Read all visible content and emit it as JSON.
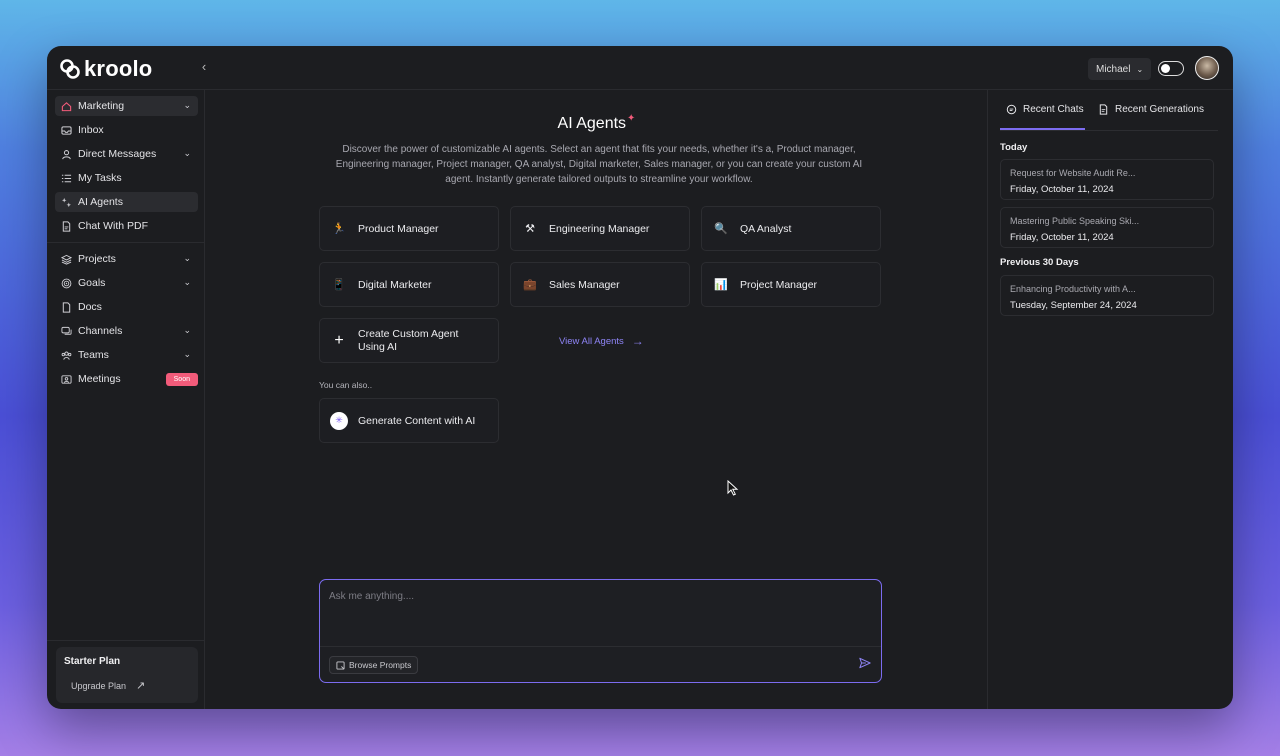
{
  "app": {
    "logo_text": "kroolo",
    "user_name": "Michael"
  },
  "sidebar": {
    "items": [
      {
        "label": "Marketing",
        "icon": "home-icon",
        "has_chevron": true
      },
      {
        "label": "Inbox",
        "icon": "inbox-icon",
        "has_chevron": false
      },
      {
        "label": "Direct Messages",
        "icon": "person-icon",
        "has_chevron": true
      },
      {
        "label": "My Tasks",
        "icon": "list-icon",
        "has_chevron": false
      },
      {
        "label": "AI Agents",
        "icon": "sparkle-icon",
        "has_chevron": false
      },
      {
        "label": "Chat With PDF",
        "icon": "pdf-icon",
        "has_chevron": false
      },
      {
        "label": "Projects",
        "icon": "layers-icon",
        "has_chevron": true
      },
      {
        "label": "Goals",
        "icon": "target-icon",
        "has_chevron": true
      },
      {
        "label": "Docs",
        "icon": "doc-icon",
        "has_chevron": false
      },
      {
        "label": "Channels",
        "icon": "chat-icon",
        "has_chevron": true
      },
      {
        "label": "Teams",
        "icon": "team-icon",
        "has_chevron": true
      },
      {
        "label": "Meetings",
        "icon": "meeting-icon",
        "has_chevron": false,
        "badge": "Soon"
      }
    ],
    "plan": {
      "title": "Starter Plan",
      "upgrade_label": "Upgrade Plan"
    }
  },
  "main": {
    "title": "AI Agents",
    "description": "Discover the power of customizable AI agents. Select an agent that fits your needs, whether it's a, Product manager, Engineering manager, Project manager, QA analyst, Digital marketer, Sales manager, or you can create your custom AI agent. Instantly generate tailored outputs to streamline your workflow.",
    "agents": [
      {
        "label": "Product Manager",
        "icon": "runner-icon"
      },
      {
        "label": "Engineering Manager",
        "icon": "tools-icon"
      },
      {
        "label": "QA Analyst",
        "icon": "magnifier-icon"
      },
      {
        "label": "Digital Marketer",
        "icon": "phone-icon"
      },
      {
        "label": "Sales Manager",
        "icon": "briefcase-icon"
      },
      {
        "label": "Project Manager",
        "icon": "bar-chart-icon"
      }
    ],
    "create_custom": "Create Custom Agent Using AI",
    "view_all": "View All Agents",
    "also_label": "You can also..",
    "generate_content": "Generate Content with AI",
    "chat": {
      "placeholder": "Ask me anything....",
      "browse_prompts": "Browse Prompts"
    }
  },
  "right_panel": {
    "tabs": [
      "Recent Chats",
      "Recent Generations"
    ],
    "sections": [
      {
        "label": "Today",
        "items": [
          {
            "title": "Request for Website Audit Re...",
            "date": "Friday, October 11, 2024"
          },
          {
            "title": "Mastering Public Speaking Ski...",
            "date": "Friday, October 11, 2024"
          }
        ]
      },
      {
        "label": "Previous 30 Days",
        "items": [
          {
            "title": "Enhancing Productivity with A...",
            "date": "Tuesday, September 24, 2024"
          }
        ]
      }
    ]
  },
  "colors": {
    "accent": "#7c6cf0",
    "brand_pink": "#f25b7a",
    "window_bg": "#1c1d20"
  }
}
